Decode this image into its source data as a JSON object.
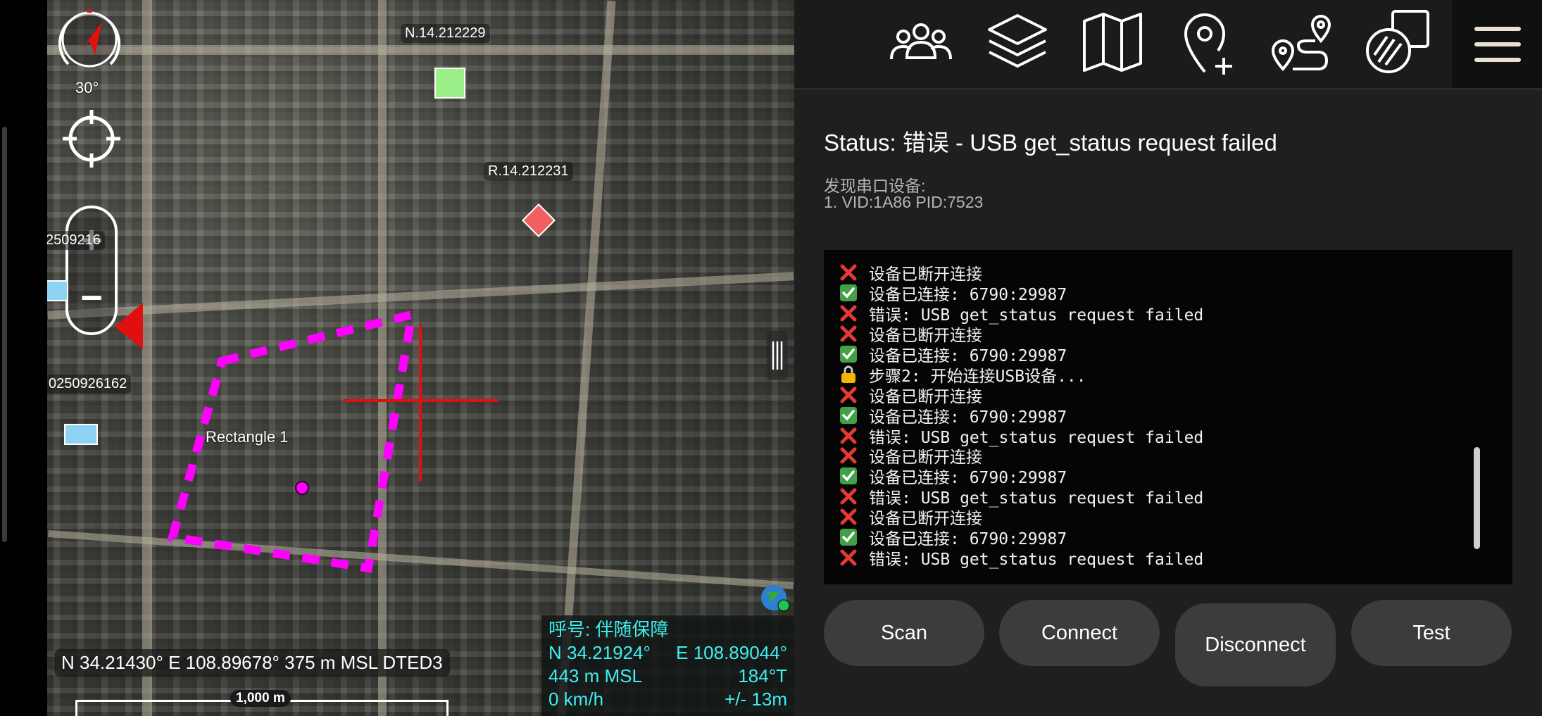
{
  "map": {
    "compass_heading": "30°",
    "labels": {
      "top_marker": "N.14.212229",
      "mid_marker": "R.14.212231",
      "left_partial_top": "2509216",
      "left_partial_bottom": "0250926162",
      "rectangle": "Rectangle 1"
    },
    "coords_bar": "N 34.21430°  E 108.89678° 375 m MSL DTED3",
    "scale_label": "1,000 m",
    "info": {
      "callsign": "呼号: 伴随保障",
      "lat": "N 34.21924°",
      "lon": "E 108.89044°",
      "altitude": "443 m MSL",
      "heading": "184°T",
      "speed": "0 km/h",
      "accuracy": "+/- 13m"
    },
    "colors": {
      "crosshair": "#e01010",
      "rectangle": "#ff00ff",
      "info_text": "#3ff0f0"
    }
  },
  "toolbar": {
    "icons": [
      "team-icon",
      "layers-icon",
      "map-icon",
      "add-place-icon",
      "route-icon",
      "overlay-icon",
      "menu-icon"
    ]
  },
  "panel": {
    "status": "Status: 错误 - USB get_status request failed",
    "serial_heading": "发现串口设备:",
    "serial_devices": [
      "1. VID:1A86 PID:7523"
    ],
    "log": [
      {
        "icon": "error",
        "text": "设备已断开连接"
      },
      {
        "icon": "ok",
        "text": "设备已连接: 6790:29987"
      },
      {
        "icon": "error",
        "text": "错误: USB get_status request failed"
      },
      {
        "icon": "error",
        "text": "设备已断开连接"
      },
      {
        "icon": "ok",
        "text": "设备已连接: 6790:29987"
      },
      {
        "icon": "lock",
        "text": "步骤2: 开始连接USB设备..."
      },
      {
        "icon": "error",
        "text": "设备已断开连接"
      },
      {
        "icon": "ok",
        "text": "设备已连接: 6790:29987"
      },
      {
        "icon": "error",
        "text": "错误: USB get_status request failed"
      },
      {
        "icon": "error",
        "text": "设备已断开连接"
      },
      {
        "icon": "ok",
        "text": "设备已连接: 6790:29987"
      },
      {
        "icon": "error",
        "text": "错误: USB get_status request failed"
      },
      {
        "icon": "error",
        "text": "设备已断开连接"
      },
      {
        "icon": "ok",
        "text": "设备已连接: 6790:29987"
      },
      {
        "icon": "error",
        "text": "错误: USB get_status request failed"
      }
    ],
    "buttons": {
      "scan": "Scan",
      "connect": "Connect",
      "disconnect": "Disconnect",
      "test": "Test"
    }
  }
}
